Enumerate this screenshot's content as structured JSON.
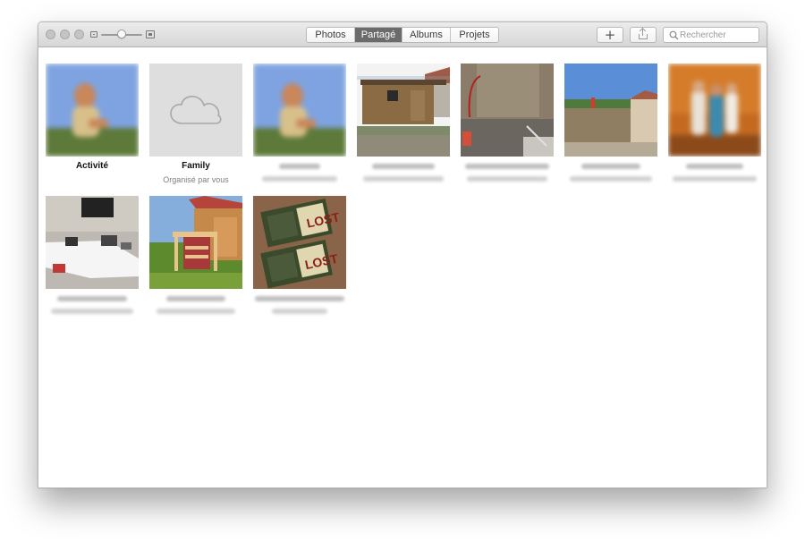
{
  "window": {
    "tabs": [
      {
        "label": "Photos",
        "active": false
      },
      {
        "label": "Partagé",
        "active": true
      },
      {
        "label": "Albums",
        "active": false
      },
      {
        "label": "Projets",
        "active": false
      }
    ],
    "add_button_icon": "plus-icon",
    "share_button_icon": "share-icon",
    "search": {
      "placeholder": "Rechercher",
      "icon": "search-icon"
    }
  },
  "albums": [
    {
      "title": "Activité",
      "subtitle": ""
    },
    {
      "title": "Family",
      "subtitle": "Organisé par vous"
    }
  ],
  "colors": {
    "active_tab": "#6b6b6b",
    "cloud_tile": "#dedede",
    "titlebar_top": "#ececec",
    "titlebar_bottom": "#d6d6d6"
  }
}
